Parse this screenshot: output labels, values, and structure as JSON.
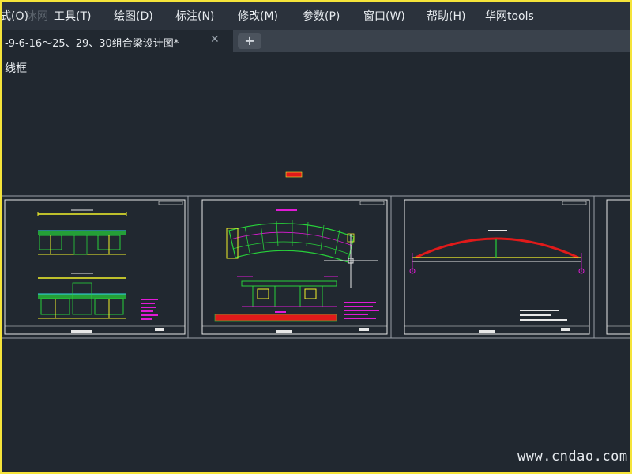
{
  "menu": {
    "items": [
      "式(O)",
      "工具(T)",
      "绘图(D)",
      "标注(N)",
      "修改(M)",
      "参数(P)",
      "窗口(W)",
      "帮助(H)",
      "华网tools"
    ],
    "ghost_text": "冰网"
  },
  "tabs": [
    {
      "label": "-9-6-16～25、29、30组合梁设计图*",
      "active": true,
      "close_glyph": "✕"
    }
  ],
  "new_tab_glyph": "+",
  "viewport": {
    "label": "线框"
  },
  "watermark": "www.cndao.com",
  "colors": {
    "background": "#212830",
    "menubar": "#2b323c",
    "tabbar": "#3a424c",
    "frame": "#f5e43a",
    "drawing_green": "#27d13a",
    "drawing_yellow": "#f2f22a",
    "drawing_magenta": "#e01ad6",
    "drawing_red": "#e01a1a",
    "drawing_white": "#e8e8e8",
    "drawing_cyan": "#33d6e6"
  }
}
